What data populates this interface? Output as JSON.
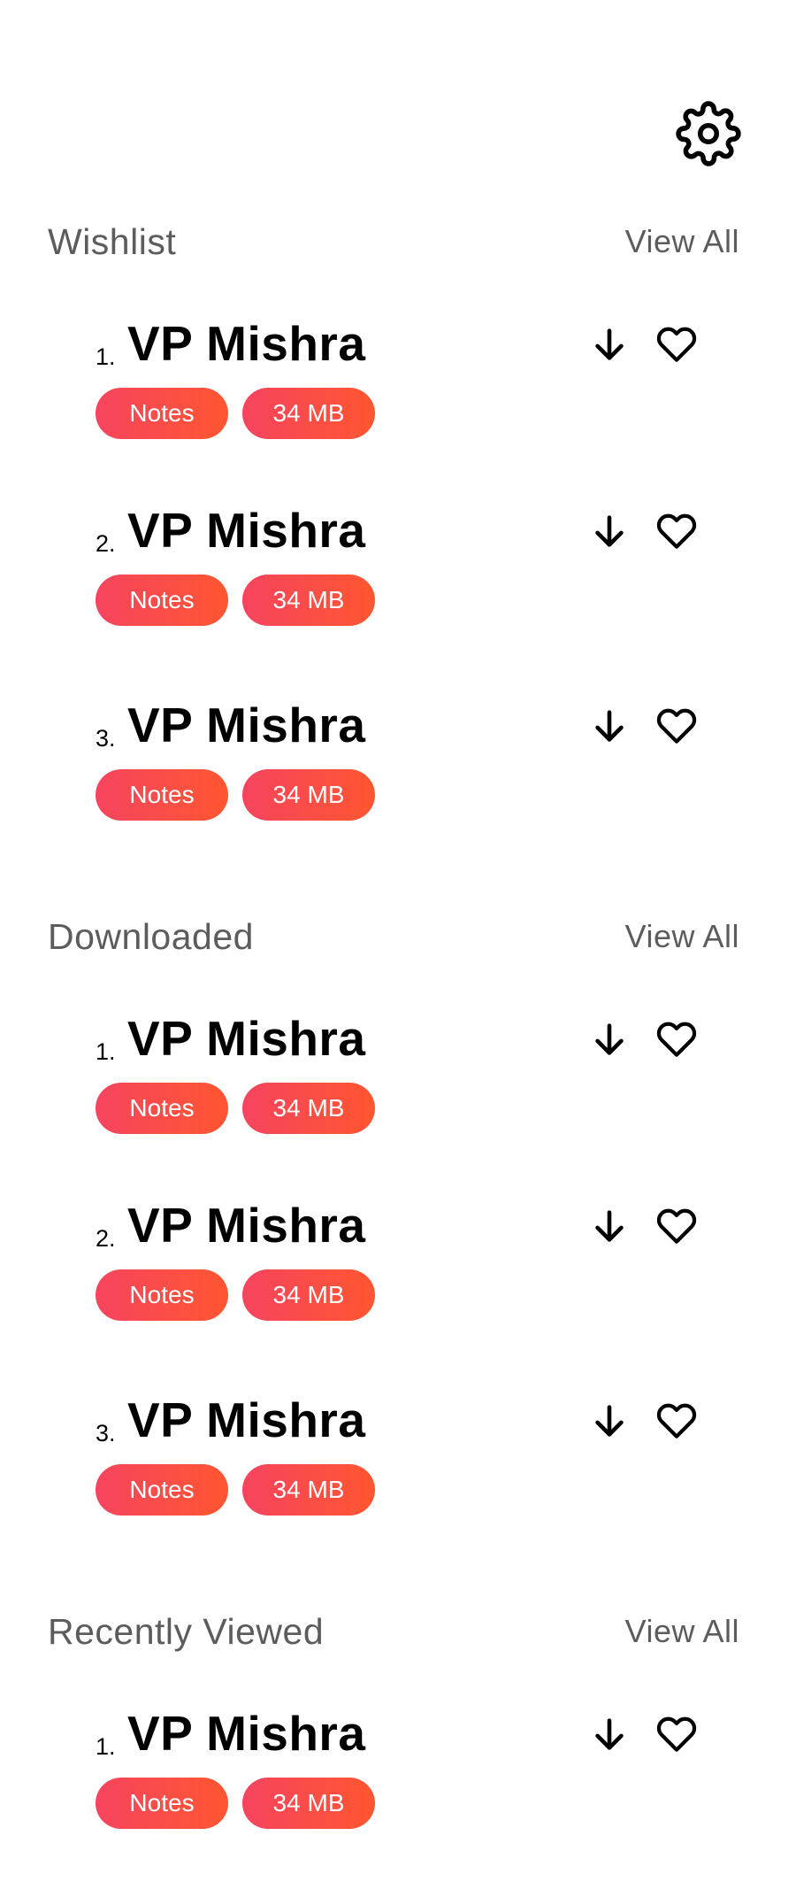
{
  "colors": {
    "chip_start": "#f6445f",
    "chip_end": "#ff5630",
    "section_title": "#5c5c5c",
    "text": "#000000",
    "background": "#ffffff"
  },
  "header": {
    "settings_icon": "gear-icon"
  },
  "sections": [
    {
      "title": "Wishlist",
      "view_all": "View All",
      "items": [
        {
          "number": "1.",
          "title": "VP Mishra",
          "type": "Notes",
          "size": "34 MB"
        },
        {
          "number": "2.",
          "title": "VP Mishra",
          "type": "Notes",
          "size": "34 MB"
        },
        {
          "number": "3.",
          "title": "VP Mishra",
          "type": "Notes",
          "size": "34 MB"
        }
      ]
    },
    {
      "title": "Downloaded",
      "view_all": "View All",
      "items": [
        {
          "number": "1.",
          "title": "VP Mishra",
          "type": "Notes",
          "size": "34 MB"
        },
        {
          "number": "2.",
          "title": "VP Mishra",
          "type": "Notes",
          "size": "34 MB"
        },
        {
          "number": "3.",
          "title": "VP Mishra",
          "type": "Notes",
          "size": "34 MB"
        }
      ]
    },
    {
      "title": "Recently Viewed",
      "view_all": "View All",
      "items": [
        {
          "number": "1.",
          "title": "VP Mishra",
          "type": "Notes",
          "size": "34 MB"
        }
      ]
    }
  ]
}
